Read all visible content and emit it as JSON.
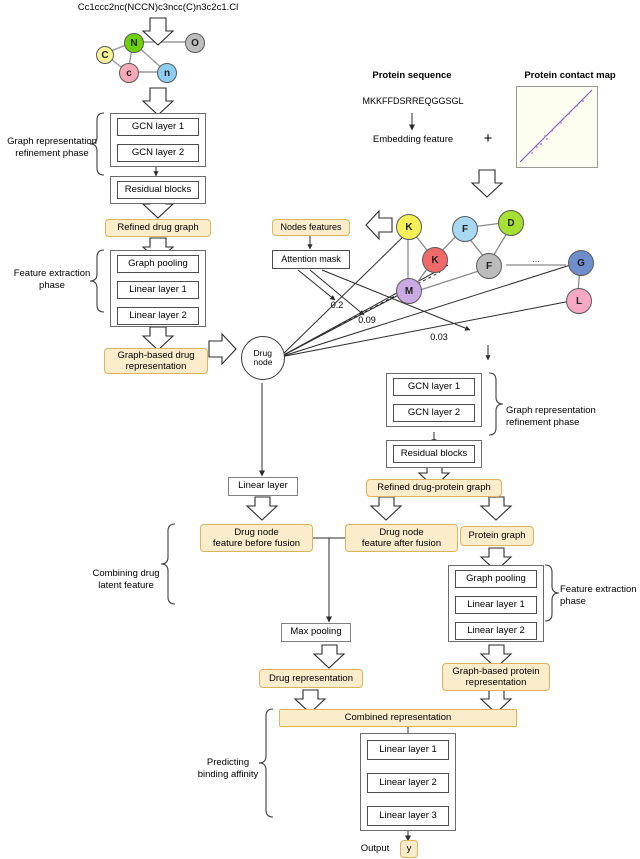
{
  "drug_input": {
    "smiles": "Cc1ccc2nc(NCCN)c3ncc(C)n3c2c1.Cl",
    "molecule_nodes": [
      {
        "label": "N",
        "color": "#6dd400"
      },
      {
        "label": "C",
        "color": "#f7f39a"
      },
      {
        "label": "c",
        "color": "#f9a8b8"
      },
      {
        "label": "n",
        "color": "#8ecdf2"
      },
      {
        "label": "O",
        "color": "#bdbdbd"
      }
    ]
  },
  "protein_input": {
    "sequence_title": "Protein sequence",
    "sequence": "MKKFFDSRREQGGSGL",
    "embedding_label": "Embedding feature",
    "plus": "+",
    "contact_map_title": "Protein contact map"
  },
  "protein_graph": {
    "nodes": [
      {
        "label": "K",
        "color": "#f5f055"
      },
      {
        "label": "F",
        "color": "#a8d8f2"
      },
      {
        "label": "D",
        "color": "#a5e033"
      },
      {
        "label": "K",
        "color": "#f06a6a"
      },
      {
        "label": "F",
        "color": "#bcbcbc"
      },
      {
        "label": "M",
        "color": "#cbaae4"
      },
      {
        "label": "G",
        "color": "#6f8fcc"
      },
      {
        "label": "L",
        "color": "#f7a8c4"
      }
    ],
    "ellipsis": "..."
  },
  "attention": {
    "nodes_features_label": "Nodes features",
    "attention_mask_label": "Attention mask",
    "weights": [
      "0.2",
      "0.09",
      "0.03"
    ]
  },
  "drug_branch": {
    "phase1_label": "Graph representation\nrefinement phase",
    "gcn_layer_1": "GCN layer 1",
    "gcn_layer_2": "GCN layer 2",
    "residual_blocks": "Residual blocks",
    "refined_drug_graph": "Refined drug graph",
    "phase2_label": "Feature extraction\nphase",
    "graph_pooling": "Graph pooling",
    "linear_layer_1": "Linear layer 1",
    "linear_layer_2": "Linear layer 2",
    "graph_based_drug_representation": "Graph-based drug\nrepresentation",
    "drug_node": "Drug\nnode",
    "linear_layer": "Linear layer"
  },
  "fusion_branch": {
    "phase_label": "Graph representation\nrefinement phase",
    "gcn_layer_1": "GCN layer 1",
    "gcn_layer_2": "GCN layer 2",
    "residual_blocks": "Residual blocks",
    "refined_drug_protein_graph": "Refined drug-protein graph",
    "drug_node_before": "Drug node\nfeature before fusion",
    "drug_node_after": "Drug node\nfeature after fusion",
    "combining_label": "Combining drug\nlatent feature",
    "max_pooling": "Max pooling",
    "drug_representation": "Drug representation"
  },
  "protein_branch": {
    "protein_graph_label": "Protein graph",
    "phase_label": "Feature extraction\nphase",
    "graph_pooling": "Graph pooling",
    "linear_layer_1": "Linear layer 1",
    "linear_layer_2": "Linear layer 2",
    "graph_based_protein_representation": "Graph-based protein\nrepresentation"
  },
  "prediction": {
    "combined_representation": "Combined representation",
    "predicting_label": "Predicting\nbinding affinity",
    "linear_layer_1": "Linear layer 1",
    "linear_layer_2": "Linear layer 2",
    "linear_layer_3": "Linear layer 3",
    "output_label": "Output",
    "output_value": "y"
  },
  "colors": {
    "highlight_fill": "#fbeccc",
    "highlight_border": "#d9b45a",
    "line": "#2b2b2b",
    "contact_map_diagonal": "#8855cc"
  }
}
